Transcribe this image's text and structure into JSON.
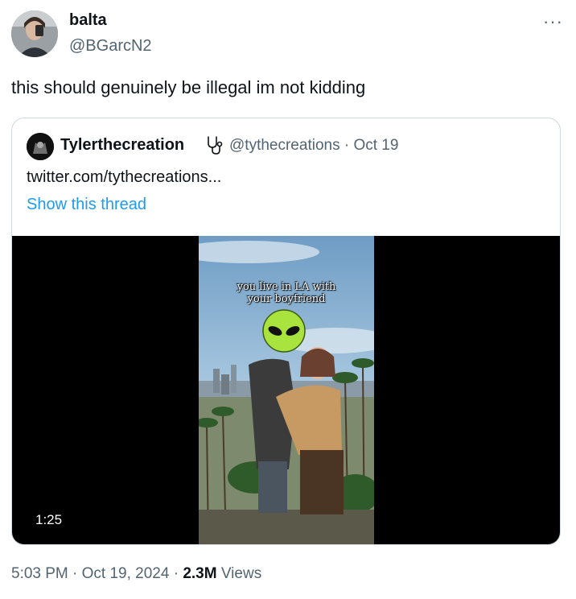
{
  "tweet": {
    "author_name": "balta",
    "author_handle": "@BGarcN2",
    "more_label": "···",
    "text": "this should genuinely be illegal im not kidding"
  },
  "quote": {
    "author_name": "Tylerthecreation",
    "author_badge_icon": "stethoscope-icon",
    "author_handle": "@tythecreations · Oct 19",
    "link_text": "twitter.com/tythecreations...",
    "show_thread": "Show this thread",
    "video": {
      "caption_line1": "you live in LA with",
      "caption_line2": "your boyfriend",
      "duration": "1:25"
    }
  },
  "meta": {
    "timestamp": "5:03 PM · Oct 19, 2024 · ",
    "views_count": "2.3M",
    "views_label": " Views"
  },
  "colors": {
    "text": "#0f1419",
    "secondary": "#536471",
    "link": "#1d9bf0",
    "border": "#cfd9de"
  }
}
